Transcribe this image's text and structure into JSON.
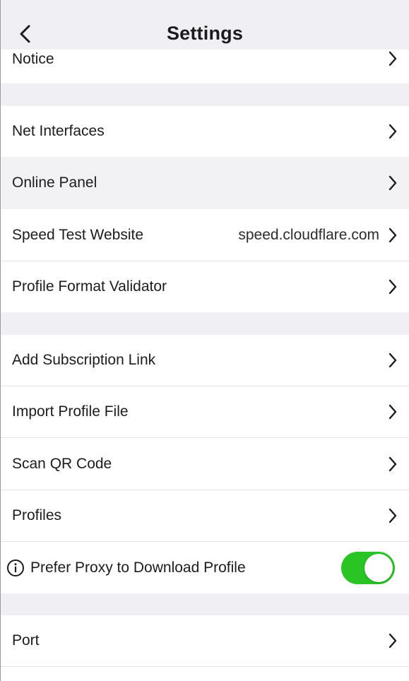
{
  "nav": {
    "title": "Settings"
  },
  "rows": {
    "notice": {
      "label": "Notice"
    },
    "net_interfaces": {
      "label": "Net Interfaces"
    },
    "online_panel": {
      "label": "Online Panel"
    },
    "speed_test": {
      "label": "Speed Test Website",
      "value": "speed.cloudflare.com"
    },
    "profile_validator": {
      "label": "Profile Format Validator"
    },
    "add_subscription": {
      "label": "Add Subscription Link"
    },
    "import_profile": {
      "label": "Import Profile File"
    },
    "scan_qr": {
      "label": "Scan QR Code"
    },
    "profiles": {
      "label": "Profiles"
    },
    "prefer_proxy": {
      "label": "Prefer Proxy to Download Profile",
      "toggle_on": true
    },
    "port": {
      "label": "Port"
    }
  },
  "colors": {
    "background": "#efeff4",
    "cell": "#ffffff",
    "toggle_on": "#2ac524"
  }
}
